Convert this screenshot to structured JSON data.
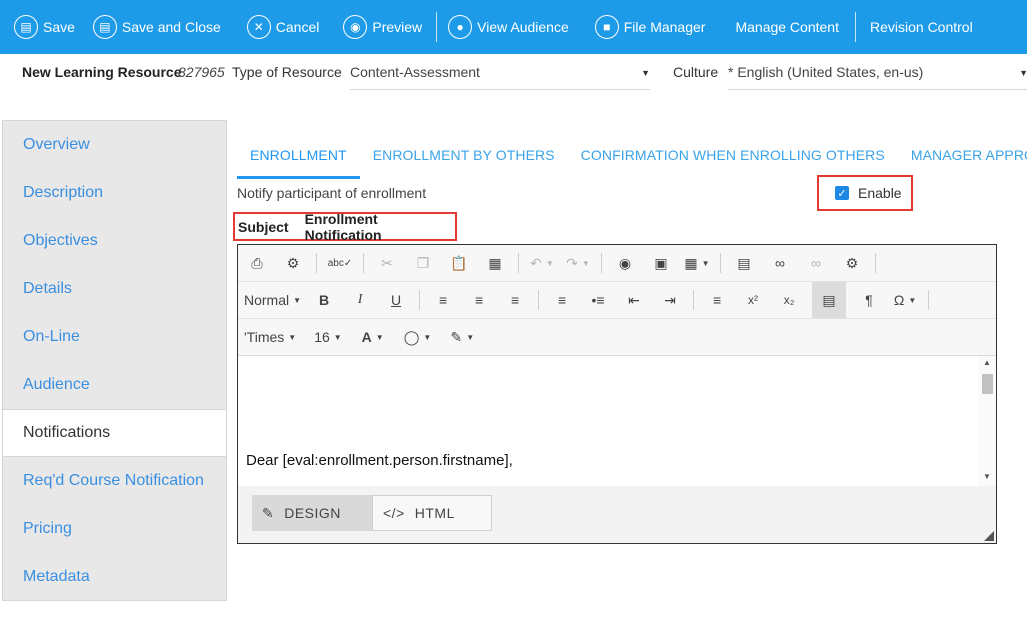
{
  "toolbar": {
    "save": "Save",
    "save_close": "Save and Close",
    "cancel": "Cancel",
    "preview": "Preview",
    "view_audience": "View Audience",
    "file_manager": "File Manager",
    "manage_content": "Manage Content",
    "revision_control": "Revision Control"
  },
  "header": {
    "title": "New Learning Resource",
    "resource_id": "827965",
    "type_label": "Type of Resource",
    "type_value": "Content-Assessment",
    "culture_label": "Culture",
    "culture_value": "* English (United States, en-us)"
  },
  "sidebar": {
    "items": [
      {
        "label": "Overview"
      },
      {
        "label": "Description"
      },
      {
        "label": "Objectives"
      },
      {
        "label": "Details"
      },
      {
        "label": "On-Line"
      },
      {
        "label": "Audience"
      },
      {
        "label": "Notifications"
      },
      {
        "label": "Req'd Course Notification"
      },
      {
        "label": "Pricing"
      },
      {
        "label": "Metadata"
      }
    ],
    "active_index": 6
  },
  "tabs": [
    {
      "label": "ENROLLMENT"
    },
    {
      "label": "ENROLLMENT BY OTHERS"
    },
    {
      "label": "CONFIRMATION WHEN ENROLLING OTHERS"
    },
    {
      "label": "MANAGER APPROVED"
    }
  ],
  "notify_label": "Notify participant of enrollment",
  "enable": {
    "label": "Enable",
    "checked": true
  },
  "subject": {
    "label": "Subject",
    "value": "Enrollment Notification"
  },
  "editor": {
    "format": "Normal",
    "font": "'Times",
    "size": "16",
    "font_color_label": "A",
    "body_line": "Dear [eval:enrollment.person.firstname],",
    "design_tab": "DESIGN",
    "html_tab": "HTML"
  },
  "colors": {
    "toolbar": "#1e9be8",
    "link": "#3a8fe0",
    "highlight": "#e53935"
  }
}
